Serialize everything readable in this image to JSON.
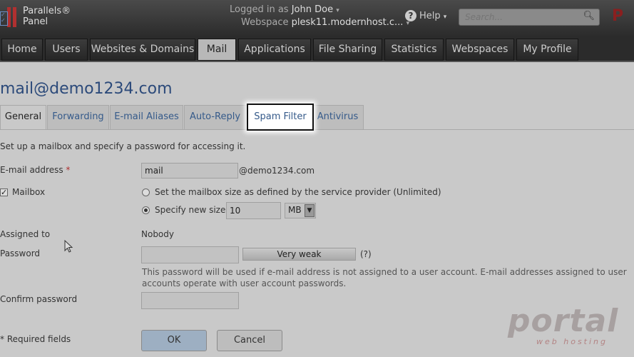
{
  "topbar": {
    "brand_line1": "Parallels®",
    "brand_line2": "Panel",
    "logged_in_label": "Logged in as",
    "user_name": "John Doe",
    "webspace_label": "Webspace",
    "webspace_value": "plesk11.modernhost.c...",
    "help_label": "Help",
    "search_placeholder": "Search...",
    "brand_right": "P"
  },
  "nav": {
    "tabs": [
      {
        "label": "Home",
        "active": false
      },
      {
        "label": "Users",
        "active": false
      },
      {
        "label": "Websites & Domains",
        "active": false
      },
      {
        "label": "Mail",
        "active": true
      },
      {
        "label": "Applications",
        "active": false
      },
      {
        "label": "File Sharing",
        "active": false
      },
      {
        "label": "Statistics",
        "active": false
      },
      {
        "label": "Webspaces",
        "active": false
      },
      {
        "label": "My Profile",
        "active": false
      }
    ]
  },
  "page": {
    "title": "mail@demo1234.com",
    "subtabs": [
      {
        "label": "General",
        "active": true
      },
      {
        "label": "Forwarding",
        "active": false
      },
      {
        "label": "E-mail Aliases",
        "active": false
      },
      {
        "label": "Auto-Reply",
        "active": false
      },
      {
        "label": "Spam Filter",
        "active": false,
        "highlighted": true
      },
      {
        "label": "Antivirus",
        "active": false
      }
    ],
    "intro": "Set up a mailbox and specify a password for accessing it."
  },
  "form": {
    "email_label": "E-mail address",
    "required_mark": "*",
    "email_value": "mail",
    "email_domain": "@demo1234.com",
    "mailbox_label": "Mailbox",
    "mailbox_checked": true,
    "size_option1": "Set the mailbox size as defined by the service provider (Unlimited)",
    "size_option2": "Specify new size",
    "size_value": "10",
    "size_unit": "MB",
    "assigned_label": "Assigned to",
    "assigned_value": "Nobody",
    "password_label": "Password",
    "password_value": "",
    "strength_text": "Very weak",
    "help_mark": "(?)",
    "password_note": "This password will be used if e-mail address is not assigned to a user account. E-mail addresses assigned to user accounts operate with user account passwords.",
    "confirm_label": "Confirm password",
    "confirm_value": "",
    "required_note": "* Required fields",
    "ok_label": "OK",
    "cancel_label": "Cancel"
  },
  "watermark": {
    "main": "portal",
    "sub": "web hosting"
  },
  "colors": {
    "brand_red": "#b03030",
    "link_blue": "#355a8a",
    "title_blue": "#2c4a7a"
  }
}
